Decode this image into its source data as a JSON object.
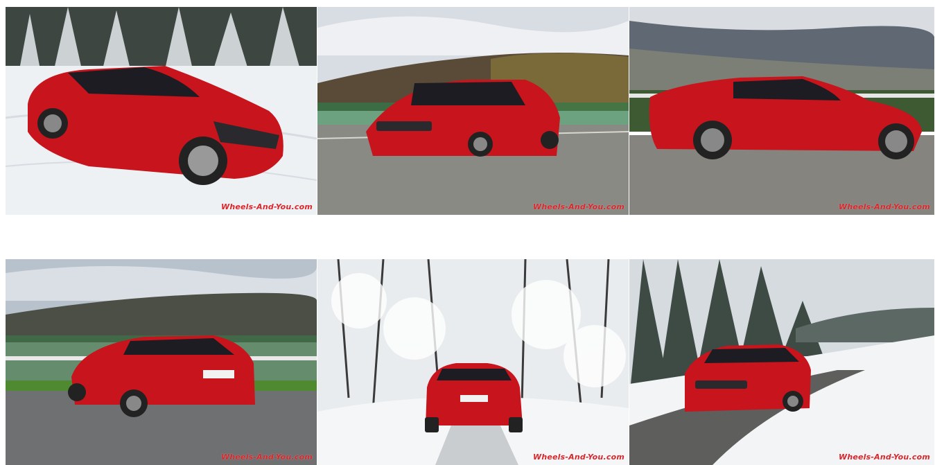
{
  "gallery": {
    "images": [
      {
        "watermark": "Wheels-And-You.com",
        "alt": "Red Kia Stinger GT in snow, front three-quarter view"
      },
      {
        "watermark": "Wheels-And-You.com",
        "alt": "Red Kia Stinger GT front view on racetrack"
      },
      {
        "watermark": "Wheels-And-You.com",
        "alt": "Red Kia Stinger GT side profile on racetrack"
      },
      {
        "watermark": "Wheels-And-You.com",
        "alt": "Red Kia Stinger GT rear three-quarter view"
      },
      {
        "watermark": "Wheels-And-You.com",
        "alt": "Red Kia Stinger GT rear view on snowy forest road"
      },
      {
        "watermark": "Wheels-And-You.com",
        "alt": "Red Kia Stinger GT front view on snowy road"
      }
    ]
  },
  "colors": {
    "watermark": "#d9262b",
    "car_red": "#c8141c",
    "snow": "#eef1f4"
  }
}
